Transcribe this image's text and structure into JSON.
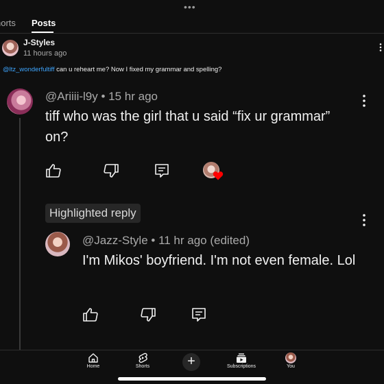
{
  "tabs": {
    "shorts_label": "horts",
    "posts_label": "Posts"
  },
  "post": {
    "author": "J-Styles",
    "time": "11 hours ago",
    "mention": "@ltz_wonderfultiff",
    "text": " can u reheart me? Now I fixed my grammar and spelling?"
  },
  "comment": {
    "handle_line": "@Ariiii-l9y • 15 hr ago",
    "text": "tiff who was the girl that u said “fix ur grammar” on?"
  },
  "reply": {
    "badge": "Highlighted reply",
    "handle_line": "@Jazz-Style • 11 hr ago (edited)",
    "text": "I'm Mikos' boyfriend. I'm not even female. Lol"
  },
  "nav": {
    "home": "Home",
    "shorts": "Shorts",
    "create": "+",
    "subscriptions": "Subscriptions",
    "you": "You"
  },
  "colors": {
    "background": "#0f0f0f",
    "mention": "#3ea6ff",
    "heart": "#ff0000"
  },
  "icons": [
    "more-horizontal-icon",
    "more-vertical-icon",
    "thumb-up-icon",
    "thumb-down-icon",
    "reply-icon",
    "heart-icon",
    "home-icon",
    "shorts-icon",
    "plus-icon",
    "subscriptions-icon"
  ]
}
